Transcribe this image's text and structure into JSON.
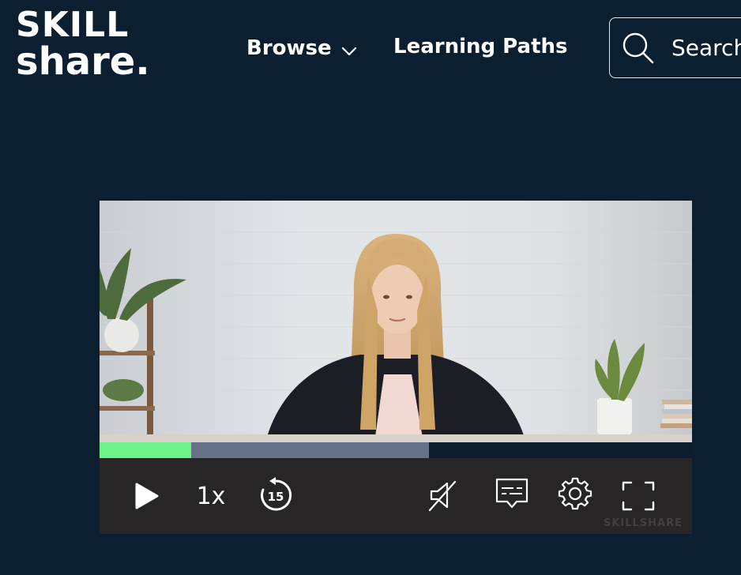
{
  "brand": {
    "logo_line1": "SKILL",
    "logo_line2": "share.",
    "colors": {
      "background": "#0b1f31",
      "progress_played": "#6ef28a",
      "progress_buffered": "#65728a",
      "text": "#ffffff"
    }
  },
  "header": {
    "nav": [
      {
        "label": "Browse",
        "icon": "chevron-down-icon"
      },
      {
        "label": "Learning Paths"
      }
    ],
    "search": {
      "icon": "search-icon",
      "placeholder": "Search"
    }
  },
  "player": {
    "progress": {
      "played_fraction": 0.155,
      "buffered_fraction": 0.556
    },
    "controls": {
      "play_icon": "play-icon",
      "speed_label": "1x",
      "rewind_label": "15",
      "rewind_icon": "rewind-15-icon",
      "mute_icon": "volume-muted-icon",
      "captions_icon": "captions-icon",
      "settings_icon": "gear-icon",
      "fullscreen_icon": "fullscreen-icon"
    },
    "watermark": "SKILLSHARE"
  }
}
